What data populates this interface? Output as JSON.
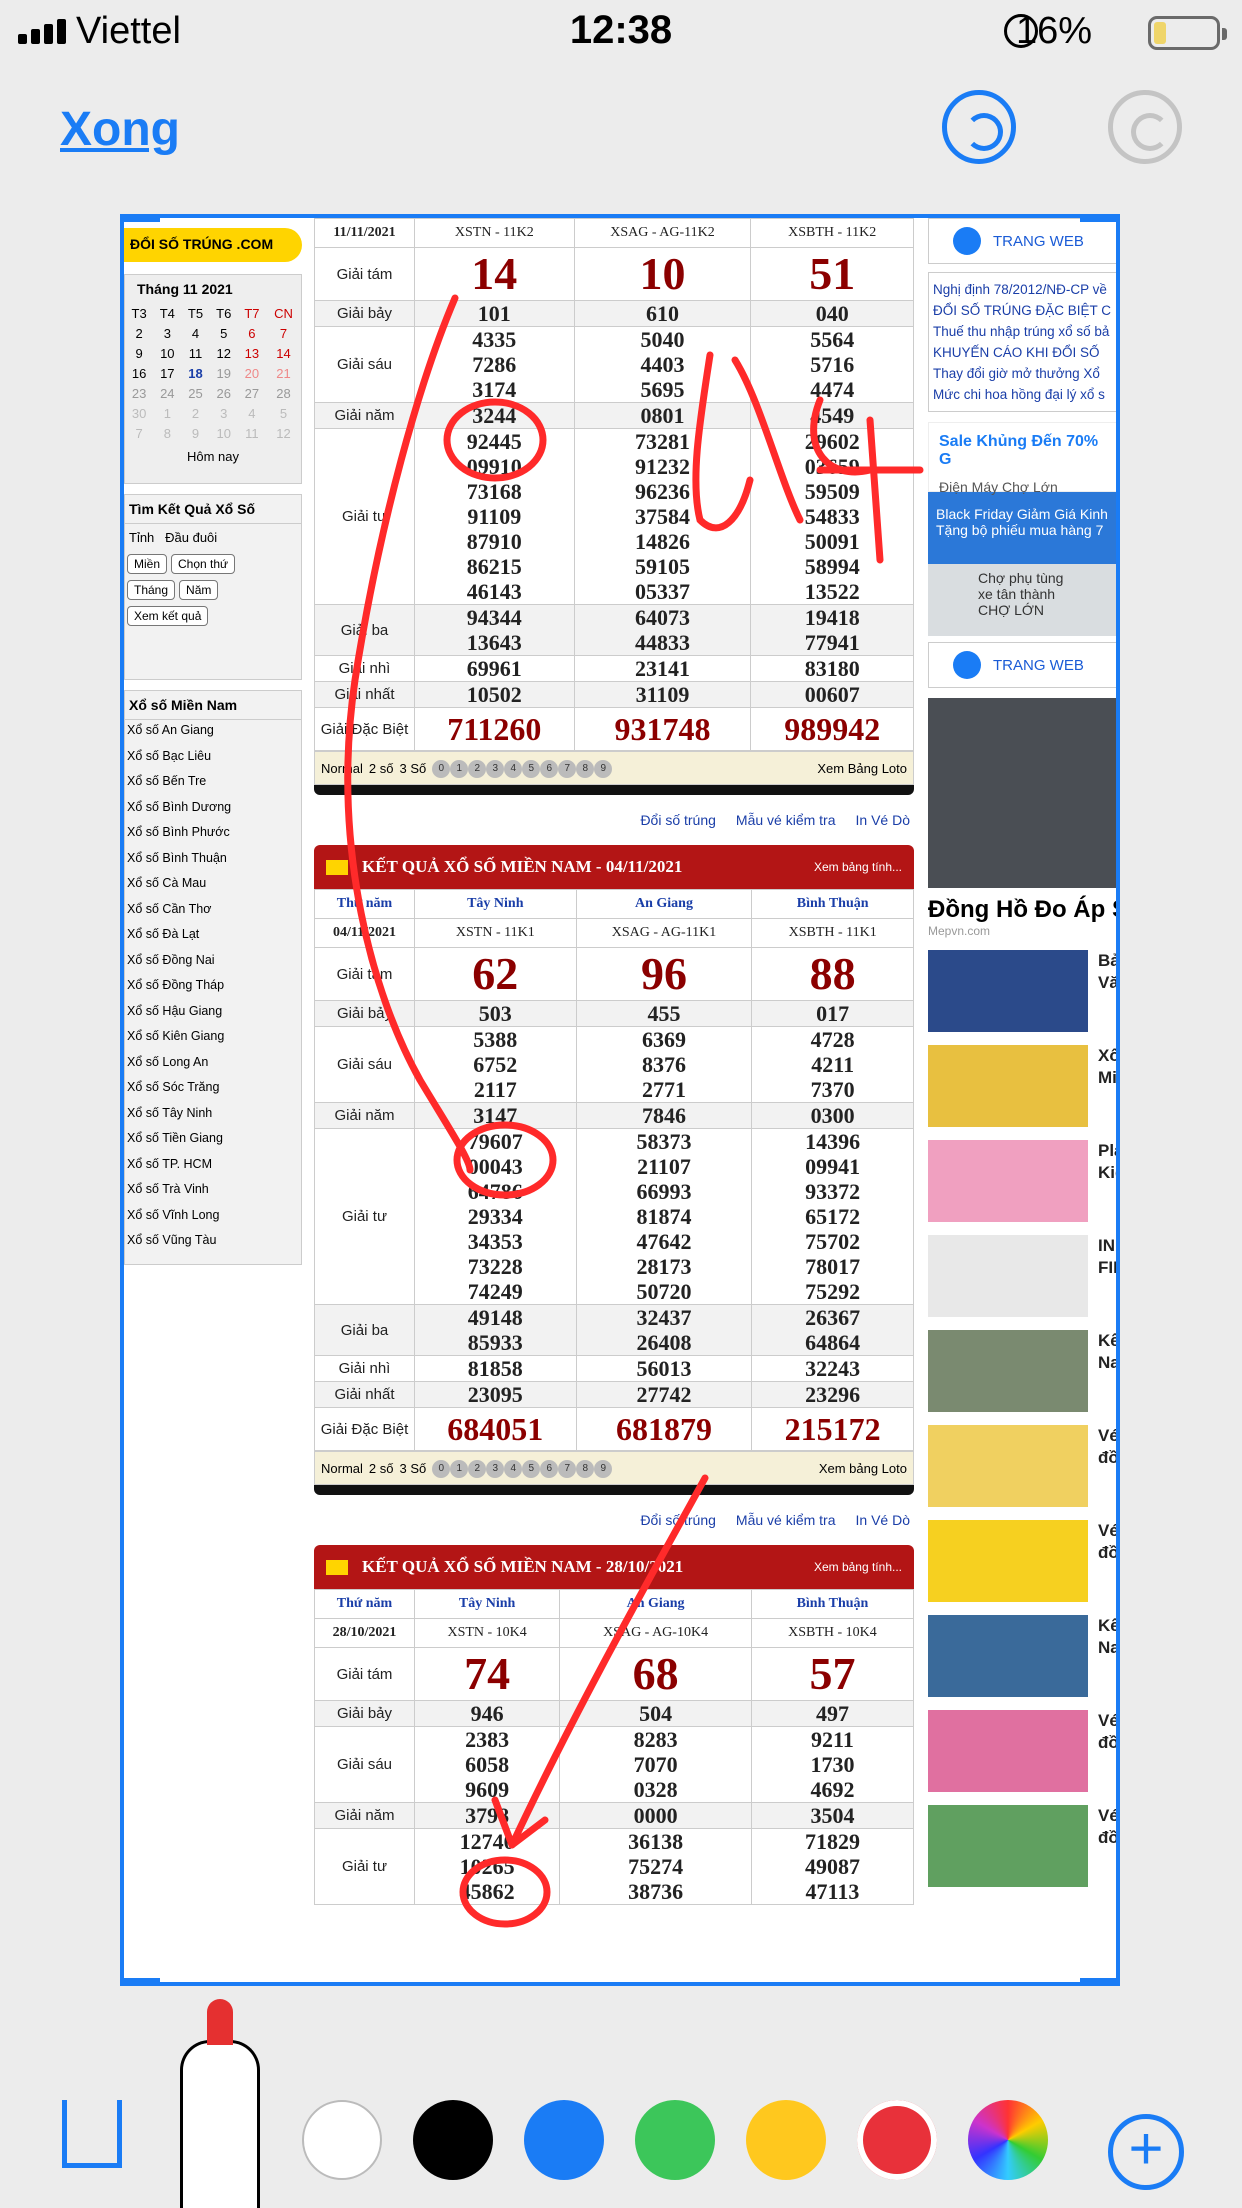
{
  "status": {
    "carrier": "Viettel",
    "time": "12:38",
    "battery": "16%"
  },
  "toolbar": {
    "done": "Xong"
  },
  "site": {
    "logo": "ĐỔI SỐ TRÚNG .COM",
    "calendar_title": "Tháng 11 2021",
    "today": "Hôm nay",
    "search_title": "Tìm Kết Quả Xổ Số",
    "radio1": "Tỉnh",
    "radio2": "Đầu đuôi",
    "sel_region": "Miền",
    "sel_day": "Chọn thứ",
    "sel_month": "Tháng",
    "sel_year": "Năm",
    "view_btn": "Xem kết quả",
    "mn_title": "Xổ số Miền Nam",
    "mn_items": [
      "Xổ số An Giang",
      "Xổ số Bạc Liêu",
      "Xổ số Bến Tre",
      "Xổ số Bình Dương",
      "Xổ số Bình Phước",
      "Xổ số Bình Thuận",
      "Xổ số Cà Mau",
      "Xổ số Cần Thơ",
      "Xổ số Đà Lạt",
      "Xổ số Đồng Nai",
      "Xổ số Đồng Tháp",
      "Xổ số Hậu Giang",
      "Xổ số Kiên Giang",
      "Xổ số Long An",
      "Xổ số Sóc Trăng",
      "Xổ số Tây Ninh",
      "Xổ số Tiền Giang",
      "Xổ số TP. HCM",
      "Xổ số Trà Vinh",
      "Xổ số Vĩnh Long",
      "Xổ số Vũng Tàu"
    ]
  },
  "labels": {
    "g8": "Giải tám",
    "g7": "Giải bảy",
    "g6": "Giải sáu",
    "g5": "Giải năm",
    "g4": "Giải tư",
    "g3": "Giải ba",
    "g2": "Giải nhì",
    "g1": "Giải nhất",
    "db": "Giải Đặc Biệt",
    "day": "Thứ năm"
  },
  "loto": {
    "normal": "Normal",
    "two": "2 số",
    "three": "3 Số",
    "xem": "Xem Bảng Loto",
    "xem2": "Xem bảng Loto"
  },
  "links": {
    "doi": "Đổi số trúng",
    "mau": "Mẫu vé kiểm tra",
    "in": "In Vé Dò"
  },
  "draw1": {
    "date": "11/11/2021",
    "codes": [
      "XSTN - 11K2",
      "XSAG - AG-11K2",
      "XSBTH - 11K2"
    ],
    "g8": [
      "14",
      "10",
      "51"
    ],
    "g7": [
      "101",
      "610",
      "040"
    ],
    "g6": [
      [
        "4335",
        "7286",
        "3174"
      ],
      [
        "5040",
        "4403",
        "5695"
      ],
      [
        "5564",
        "5716",
        "4474"
      ]
    ],
    "g5": [
      "3244",
      "0801",
      "4549"
    ],
    "g4": [
      [
        "92445",
        "09910",
        "73168",
        "91109",
        "87910",
        "86215",
        "46143"
      ],
      [
        "73281",
        "91232",
        "96236",
        "37584",
        "14826",
        "59105",
        "05337"
      ],
      [
        "29602",
        "03659",
        "59509",
        "54833",
        "50091",
        "58994",
        "13522"
      ]
    ],
    "g3": [
      [
        "94344",
        "13643"
      ],
      [
        "64073",
        "44833"
      ],
      [
        "19418",
        "77941"
      ]
    ],
    "g2": [
      "69961",
      "23141",
      "83180"
    ],
    "g1": [
      "10502",
      "31109",
      "00607"
    ],
    "db": [
      "711260",
      "931748",
      "989942"
    ]
  },
  "draw2": {
    "banner": "KẾT QUẢ XỔ SỐ MIỀN NAM - 04/11/2021",
    "xem": "Xem bảng tính...",
    "provinces": [
      "Tây Ninh",
      "An Giang",
      "Bình Thuận"
    ],
    "date": "04/11/2021",
    "codes": [
      "XSTN - 11K1",
      "XSAG - AG-11K1",
      "XSBTH - 11K1"
    ],
    "g8": [
      "62",
      "96",
      "88"
    ],
    "g7": [
      "503",
      "455",
      "017"
    ],
    "g6": [
      [
        "5388",
        "6752",
        "2117"
      ],
      [
        "6369",
        "8376",
        "2771"
      ],
      [
        "4728",
        "4211",
        "7370"
      ]
    ],
    "g5": [
      "3147",
      "7846",
      "0300"
    ],
    "g4": [
      [
        "79607",
        "00043",
        "64786",
        "29334",
        "34353",
        "73228",
        "74249"
      ],
      [
        "58373",
        "21107",
        "66993",
        "81874",
        "47642",
        "28173",
        "50720"
      ],
      [
        "14396",
        "09941",
        "93372",
        "65172",
        "75702",
        "78017",
        "75292"
      ]
    ],
    "g3": [
      [
        "49148",
        "85933"
      ],
      [
        "32437",
        "26408"
      ],
      [
        "26367",
        "64864"
      ]
    ],
    "g2": [
      "81858",
      "56013",
      "32243"
    ],
    "g1": [
      "23095",
      "27742",
      "23296"
    ],
    "db": [
      "684051",
      "681879",
      "215172"
    ]
  },
  "draw3": {
    "banner": "KẾT QUẢ XỔ SỐ MIỀN NAM - 28/10/2021",
    "xem": "Xem bảng tính...",
    "provinces": [
      "Tây Ninh",
      "An Giang",
      "Bình Thuận"
    ],
    "date": "28/10/2021",
    "codes": [
      "XSTN - 10K4",
      "XSAG - AG-10K4",
      "XSBTH - 10K4"
    ],
    "g8": [
      "74",
      "68",
      "57"
    ],
    "g7": [
      "946",
      "504",
      "497"
    ],
    "g6": [
      [
        "2383",
        "6058",
        "9609"
      ],
      [
        "8283",
        "7070",
        "0328"
      ],
      [
        "9211",
        "1730",
        "4692"
      ]
    ],
    "g5": [
      "3798",
      "0000",
      "3504"
    ],
    "g4": [
      [
        "12740",
        "10265",
        "45862"
      ],
      [
        "36138",
        "75274",
        "38736"
      ],
      [
        "71829",
        "49087",
        "47113"
      ]
    ]
  },
  "right": {
    "web": "TRANG WEB",
    "news": [
      "Nghị định 78/2012/NĐ-CP về",
      "ĐỔI SỐ TRÚNG ĐẶC BIỆT C",
      "Thuế thu nhập trúng xổ số bả",
      "KHUYẾN CÁO KHI ĐỔI SỐ",
      "Thay đổi giờ mở thưởng Xổ",
      "Mức chi hoa hồng đại lý xổ s"
    ],
    "ad_title": "Sale Khủng Đến 70% G",
    "ad_sub": "Điện Máy Chợ Lớn",
    "ad_blue": "Black Friday Giảm Giá Kinh Tặng bộ phiếu mua hàng 7",
    "map_text": "Chợ phụ tùng xe tân thành CHỢ LỚN",
    "photo_title": "Đồng Hồ Đo Áp S",
    "photo_sub": "Mepvn.com",
    "thumbs": [
      "Bả Vă",
      "Xổ Mi",
      "Pla Kid",
      "IN FIF",
      "Kế Na",
      "Vé đồ",
      "Vé đồ",
      "Kế Na",
      "Vé đồ",
      "Vé đồ"
    ]
  },
  "colors": {
    "accent": "#1a7cf5",
    "ink": "#ff2a2a",
    "banner": "#b31515"
  }
}
